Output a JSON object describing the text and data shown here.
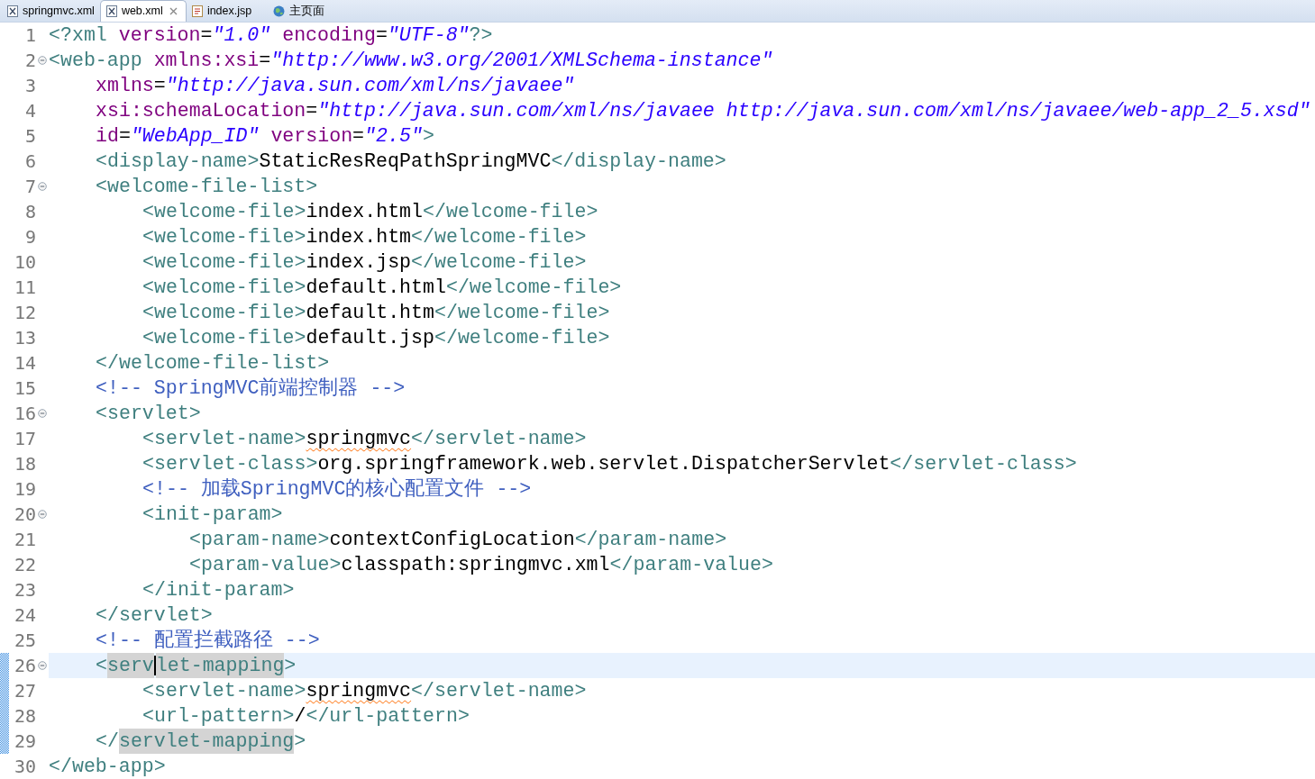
{
  "tabs": [
    {
      "label": "springmvc.xml",
      "kind": "xml",
      "selected": false,
      "closable": false
    },
    {
      "label": "web.xml",
      "kind": "xml",
      "selected": true,
      "closable": true
    },
    {
      "label": "index.jsp",
      "kind": "jsp",
      "selected": false,
      "closable": false
    },
    {
      "label": "主页面",
      "kind": "web",
      "selected": false,
      "closable": false
    }
  ],
  "editor": {
    "lines": [
      {
        "number": "1",
        "fold": false,
        "current": false,
        "changed": false,
        "tokens": [
          {
            "kind": "tag",
            "text": "<?xml"
          },
          {
            "kind": "attr",
            "text": " version"
          },
          {
            "kind": "eq",
            "text": "="
          },
          {
            "kind": "value",
            "text": "\"1.0\""
          },
          {
            "kind": "attr",
            "text": " encoding"
          },
          {
            "kind": "eq",
            "text": "="
          },
          {
            "kind": "value",
            "text": "\"UTF-8\""
          },
          {
            "kind": "tag",
            "text": "?>"
          }
        ]
      },
      {
        "number": "2",
        "fold": true,
        "current": false,
        "changed": false,
        "tokens": [
          {
            "kind": "tag",
            "text": "<web-app"
          },
          {
            "kind": "attr",
            "text": " xmlns:xsi"
          },
          {
            "kind": "eq",
            "text": "="
          },
          {
            "kind": "value",
            "text": "\"http://www.w3.org/2001/XMLSchema-instance\""
          }
        ],
        "children": [
          {
            "number": "3",
            "fold": false,
            "current": false,
            "changed": false,
            "tokens": [
              {
                "kind": "attr",
                "text": "xmlns"
              },
              {
                "kind": "eq",
                "text": "="
              },
              {
                "kind": "value",
                "text": "\"http://java.sun.com/xml/ns/javaee\""
              }
            ]
          },
          {
            "number": "4",
            "fold": false,
            "current": false,
            "changed": false,
            "tokens": [
              {
                "kind": "attr",
                "text": "xsi:schemaLocation"
              },
              {
                "kind": "eq",
                "text": "="
              },
              {
                "kind": "value",
                "text": "\"http://java.sun.com/xml/ns/javaee http://java.sun.com/xml/ns/javaee/web-app_2_5.xsd\""
              }
            ]
          },
          {
            "number": "5",
            "fold": false,
            "current": false,
            "changed": false,
            "tokens": [
              {
                "kind": "attr",
                "text": "id"
              },
              {
                "kind": "eq",
                "text": "="
              },
              {
                "kind": "value",
                "text": "\"WebApp_ID\""
              },
              {
                "kind": "attr",
                "text": " version"
              },
              {
                "kind": "eq",
                "text": "="
              },
              {
                "kind": "value",
                "text": "\"2.5\""
              },
              {
                "kind": "tag",
                "text": ">"
              }
            ]
          },
          {
            "number": "6",
            "fold": false,
            "current": false,
            "changed": false,
            "tokens": [
              {
                "kind": "tag",
                "text": "<display-name>"
              },
              {
                "kind": "text",
                "text": "StaticResReqPathSpringMVC"
              },
              {
                "kind": "tag",
                "text": "</display-name>"
              }
            ]
          },
          {
            "number": "7",
            "fold": true,
            "current": false,
            "changed": false,
            "tokens": [
              {
                "kind": "tag",
                "text": "<welcome-file-list>"
              }
            ],
            "children": [
              {
                "number": "8",
                "fold": false,
                "current": false,
                "changed": false,
                "tokens": [
                  {
                    "kind": "tag",
                    "text": "<welcome-file>"
                  },
                  {
                    "kind": "text",
                    "text": "index.html"
                  },
                  {
                    "kind": "tag",
                    "text": "</welcome-file>"
                  }
                ]
              },
              {
                "number": "9",
                "fold": false,
                "current": false,
                "changed": false,
                "tokens": [
                  {
                    "kind": "tag",
                    "text": "<welcome-file>"
                  },
                  {
                    "kind": "text",
                    "text": "index.htm"
                  },
                  {
                    "kind": "tag",
                    "text": "</welcome-file>"
                  }
                ]
              },
              {
                "number": "10",
                "fold": false,
                "current": false,
                "changed": false,
                "tokens": [
                  {
                    "kind": "tag",
                    "text": "<welcome-file>"
                  },
                  {
                    "kind": "text",
                    "text": "index.jsp"
                  },
                  {
                    "kind": "tag",
                    "text": "</welcome-file>"
                  }
                ]
              },
              {
                "number": "11",
                "fold": false,
                "current": false,
                "changed": false,
                "tokens": [
                  {
                    "kind": "tag",
                    "text": "<welcome-file>"
                  },
                  {
                    "kind": "text",
                    "text": "default.html"
                  },
                  {
                    "kind": "tag",
                    "text": "</welcome-file>"
                  }
                ]
              },
              {
                "number": "12",
                "fold": false,
                "current": false,
                "changed": false,
                "tokens": [
                  {
                    "kind": "tag",
                    "text": "<welcome-file>"
                  },
                  {
                    "kind": "text",
                    "text": "default.htm"
                  },
                  {
                    "kind": "tag",
                    "text": "</welcome-file>"
                  }
                ]
              },
              {
                "number": "13",
                "fold": false,
                "current": false,
                "changed": false,
                "tokens": [
                  {
                    "kind": "tag",
                    "text": "<welcome-file>"
                  },
                  {
                    "kind": "text",
                    "text": "default.jsp"
                  },
                  {
                    "kind": "tag",
                    "text": "</welcome-file>"
                  }
                ]
              }
            ]
          },
          {
            "number": "14",
            "fold": false,
            "current": false,
            "changed": false,
            "tokens": [
              {
                "kind": "tag",
                "text": "</welcome-file-list>"
              }
            ]
          },
          {
            "number": "15",
            "fold": false,
            "current": false,
            "changed": false,
            "tokens": [
              {
                "kind": "comment",
                "text": "<!-- SpringMVC前端控制器 -->"
              }
            ]
          },
          {
            "number": "16",
            "fold": true,
            "current": false,
            "changed": false,
            "tokens": [
              {
                "kind": "tag",
                "text": "<servlet>"
              }
            ],
            "children": [
              {
                "number": "17",
                "fold": false,
                "current": false,
                "changed": false,
                "tokens": [
                  {
                    "kind": "tag",
                    "text": "<servlet-name>"
                  },
                  {
                    "kind": "text_misspelled",
                    "text": "springmvc"
                  },
                  {
                    "kind": "tag",
                    "text": "</servlet-name>"
                  }
                ]
              },
              {
                "number": "18",
                "fold": false,
                "current": false,
                "changed": false,
                "tokens": [
                  {
                    "kind": "tag",
                    "text": "<servlet-class>"
                  },
                  {
                    "kind": "text",
                    "text": "org.springframework.web.servlet.DispatcherServlet"
                  },
                  {
                    "kind": "tag",
                    "text": "</servlet-class>"
                  }
                ]
              },
              {
                "number": "19",
                "fold": false,
                "current": false,
                "changed": false,
                "tokens": [
                  {
                    "kind": "comment",
                    "text": "<!-- 加载SpringMVC的核心配置文件 -->"
                  }
                ]
              },
              {
                "number": "20",
                "fold": true,
                "current": false,
                "changed": false,
                "tokens": [
                  {
                    "kind": "tag",
                    "text": "<init-param>"
                  }
                ],
                "children": [
                  {
                    "number": "21",
                    "fold": false,
                    "current": false,
                    "changed": false,
                    "tokens": [
                      {
                        "kind": "tag",
                        "text": "<param-name>"
                      },
                      {
                        "kind": "text",
                        "text": "contextConfigLocation"
                      },
                      {
                        "kind": "tag",
                        "text": "</param-name>"
                      }
                    ]
                  },
                  {
                    "number": "22",
                    "fold": false,
                    "current": false,
                    "changed": false,
                    "tokens": [
                      {
                        "kind": "tag",
                        "text": "<param-value>"
                      },
                      {
                        "kind": "text",
                        "text": "classpath:springmvc.xml"
                      },
                      {
                        "kind": "tag",
                        "text": "</param-value>"
                      }
                    ]
                  }
                ]
              },
              {
                "number": "23",
                "fold": false,
                "current": false,
                "changed": false,
                "tokens": [
                  {
                    "kind": "tag",
                    "text": "</init-param>"
                  }
                ]
              }
            ]
          },
          {
            "number": "24",
            "fold": false,
            "current": false,
            "changed": false,
            "tokens": [
              {
                "kind": "tag",
                "text": "</servlet>"
              }
            ]
          },
          {
            "number": "25",
            "fold": false,
            "current": false,
            "changed": false,
            "tokens": [
              {
                "kind": "comment",
                "text": "<!-- 配置拦截路径 -->"
              }
            ]
          },
          {
            "number": "26",
            "fold": true,
            "current": true,
            "changed": true,
            "tokens": [
              {
                "kind": "tag",
                "text": "<"
              },
              {
                "kind": "tag_marked",
                "text": "serv"
              },
              {
                "kind": "caret"
              },
              {
                "kind": "tag_marked",
                "text": "let-mapping"
              },
              {
                "kind": "tag",
                "text": ">"
              }
            ],
            "children": [
              {
                "number": "27",
                "fold": false,
                "current": false,
                "changed": true,
                "tokens": [
                  {
                    "kind": "tag",
                    "text": "<servlet-name>"
                  },
                  {
                    "kind": "text_misspelled",
                    "text": "springmvc"
                  },
                  {
                    "kind": "tag",
                    "text": "</servlet-name>"
                  }
                ]
              },
              {
                "number": "28",
                "fold": false,
                "current": false,
                "changed": true,
                "tokens": [
                  {
                    "kind": "tag",
                    "text": "<url-pattern>"
                  },
                  {
                    "kind": "text",
                    "text": "/"
                  },
                  {
                    "kind": "tag",
                    "text": "</url-pattern>"
                  }
                ]
              }
            ]
          },
          {
            "number": "29",
            "fold": false,
            "current": false,
            "changed": true,
            "tokens": [
              {
                "kind": "tag",
                "text": "</"
              },
              {
                "kind": "tag_marked",
                "text": "servlet-mapping"
              },
              {
                "kind": "tag",
                "text": ">"
              }
            ]
          }
        ]
      },
      {
        "number": "30",
        "fold": false,
        "current": false,
        "changed": false,
        "tokens": [
          {
            "kind": "tag",
            "text": "</web-app>"
          }
        ]
      }
    ]
  }
}
